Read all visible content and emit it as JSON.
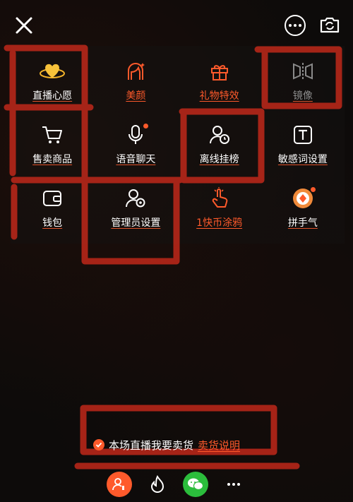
{
  "topbar": {
    "close_icon": "close-icon",
    "more_icon": "more-icon",
    "camera_icon": "flip-camera-icon"
  },
  "grid": {
    "items": [
      {
        "label": "直播心愿",
        "icon": "heart-icon",
        "style": "normal",
        "dot": false
      },
      {
        "label": "美颜",
        "icon": "beauty-icon",
        "style": "orange",
        "dot": false
      },
      {
        "label": "礼物特效",
        "icon": "gift-icon",
        "style": "orange",
        "dot": false
      },
      {
        "label": "镜像",
        "icon": "mirror-icon",
        "style": "gray",
        "dot": false
      },
      {
        "label": "售卖商品",
        "icon": "cart-icon",
        "style": "normal",
        "dot": false
      },
      {
        "label": "语音聊天",
        "icon": "microphone-icon",
        "style": "normal",
        "dot": true
      },
      {
        "label": "离线挂榜",
        "icon": "user-clock-icon",
        "style": "normal",
        "dot": false
      },
      {
        "label": "敏感词设置",
        "icon": "text-box-icon",
        "style": "normal",
        "dot": false
      },
      {
        "label": "钱包",
        "icon": "wallet-icon",
        "style": "normal",
        "dot": false
      },
      {
        "label": "管理员设置",
        "icon": "admin-icon",
        "style": "normal",
        "dot": false
      },
      {
        "label": "1快币涂鸦",
        "icon": "hand-tap-icon",
        "style": "orange",
        "dot": false
      },
      {
        "label": "拼手气",
        "icon": "lucky-icon",
        "style": "normal",
        "dot": true
      }
    ]
  },
  "notice": {
    "text": "本场直播我要卖货",
    "link": "卖货说明",
    "checked": true
  },
  "bottombar": {
    "items": [
      "voice-link-icon",
      "fire-icon",
      "wechat-icon",
      "more-dots-icon"
    ]
  },
  "colors": {
    "accent": "#ff5a2b",
    "wechat": "#2bbd3c"
  }
}
